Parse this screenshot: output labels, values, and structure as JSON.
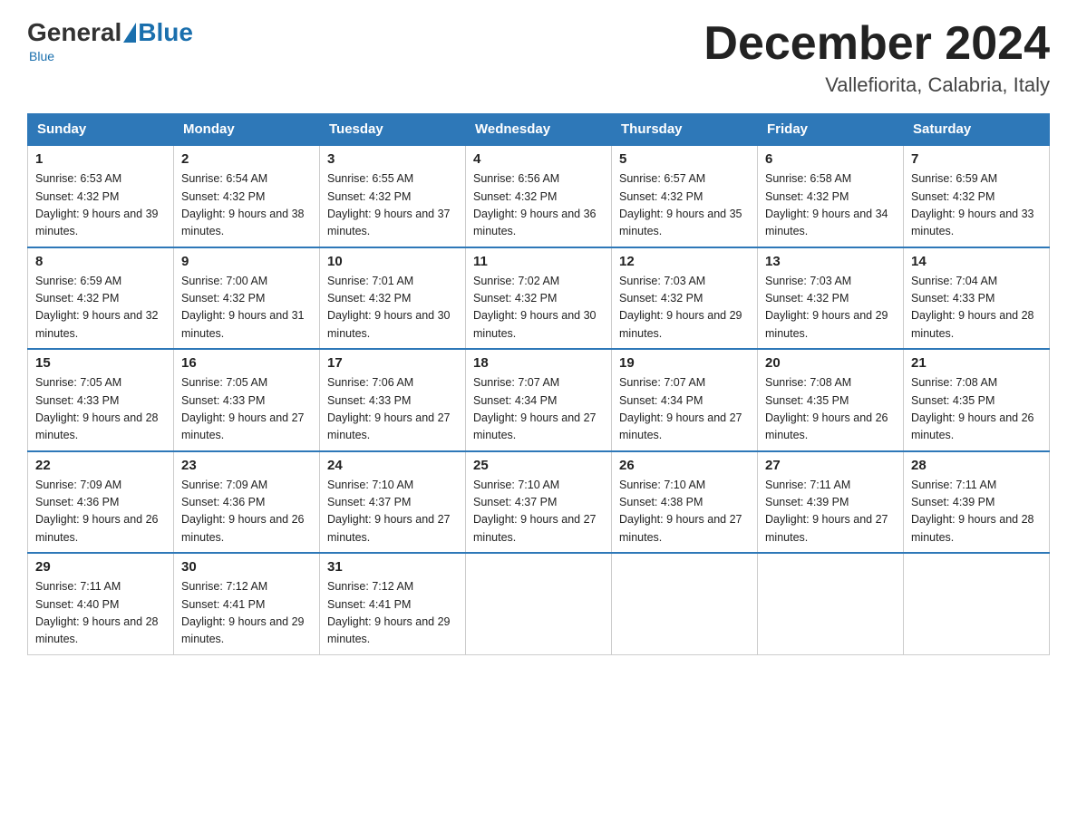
{
  "header": {
    "logo": {
      "general": "General",
      "blue": "Blue"
    },
    "month_title": "December 2024",
    "location": "Vallefiorita, Calabria, Italy"
  },
  "days_of_week": [
    "Sunday",
    "Monday",
    "Tuesday",
    "Wednesday",
    "Thursday",
    "Friday",
    "Saturday"
  ],
  "weeks": [
    [
      {
        "day": "1",
        "sunrise": "6:53 AM",
        "sunset": "4:32 PM",
        "daylight": "9 hours and 39 minutes."
      },
      {
        "day": "2",
        "sunrise": "6:54 AM",
        "sunset": "4:32 PM",
        "daylight": "9 hours and 38 minutes."
      },
      {
        "day": "3",
        "sunrise": "6:55 AM",
        "sunset": "4:32 PM",
        "daylight": "9 hours and 37 minutes."
      },
      {
        "day": "4",
        "sunrise": "6:56 AM",
        "sunset": "4:32 PM",
        "daylight": "9 hours and 36 minutes."
      },
      {
        "day": "5",
        "sunrise": "6:57 AM",
        "sunset": "4:32 PM",
        "daylight": "9 hours and 35 minutes."
      },
      {
        "day": "6",
        "sunrise": "6:58 AM",
        "sunset": "4:32 PM",
        "daylight": "9 hours and 34 minutes."
      },
      {
        "day": "7",
        "sunrise": "6:59 AM",
        "sunset": "4:32 PM",
        "daylight": "9 hours and 33 minutes."
      }
    ],
    [
      {
        "day": "8",
        "sunrise": "6:59 AM",
        "sunset": "4:32 PM",
        "daylight": "9 hours and 32 minutes."
      },
      {
        "day": "9",
        "sunrise": "7:00 AM",
        "sunset": "4:32 PM",
        "daylight": "9 hours and 31 minutes."
      },
      {
        "day": "10",
        "sunrise": "7:01 AM",
        "sunset": "4:32 PM",
        "daylight": "9 hours and 30 minutes."
      },
      {
        "day": "11",
        "sunrise": "7:02 AM",
        "sunset": "4:32 PM",
        "daylight": "9 hours and 30 minutes."
      },
      {
        "day": "12",
        "sunrise": "7:03 AM",
        "sunset": "4:32 PM",
        "daylight": "9 hours and 29 minutes."
      },
      {
        "day": "13",
        "sunrise": "7:03 AM",
        "sunset": "4:32 PM",
        "daylight": "9 hours and 29 minutes."
      },
      {
        "day": "14",
        "sunrise": "7:04 AM",
        "sunset": "4:33 PM",
        "daylight": "9 hours and 28 minutes."
      }
    ],
    [
      {
        "day": "15",
        "sunrise": "7:05 AM",
        "sunset": "4:33 PM",
        "daylight": "9 hours and 28 minutes."
      },
      {
        "day": "16",
        "sunrise": "7:05 AM",
        "sunset": "4:33 PM",
        "daylight": "9 hours and 27 minutes."
      },
      {
        "day": "17",
        "sunrise": "7:06 AM",
        "sunset": "4:33 PM",
        "daylight": "9 hours and 27 minutes."
      },
      {
        "day": "18",
        "sunrise": "7:07 AM",
        "sunset": "4:34 PM",
        "daylight": "9 hours and 27 minutes."
      },
      {
        "day": "19",
        "sunrise": "7:07 AM",
        "sunset": "4:34 PM",
        "daylight": "9 hours and 27 minutes."
      },
      {
        "day": "20",
        "sunrise": "7:08 AM",
        "sunset": "4:35 PM",
        "daylight": "9 hours and 26 minutes."
      },
      {
        "day": "21",
        "sunrise": "7:08 AM",
        "sunset": "4:35 PM",
        "daylight": "9 hours and 26 minutes."
      }
    ],
    [
      {
        "day": "22",
        "sunrise": "7:09 AM",
        "sunset": "4:36 PM",
        "daylight": "9 hours and 26 minutes."
      },
      {
        "day": "23",
        "sunrise": "7:09 AM",
        "sunset": "4:36 PM",
        "daylight": "9 hours and 26 minutes."
      },
      {
        "day": "24",
        "sunrise": "7:10 AM",
        "sunset": "4:37 PM",
        "daylight": "9 hours and 27 minutes."
      },
      {
        "day": "25",
        "sunrise": "7:10 AM",
        "sunset": "4:37 PM",
        "daylight": "9 hours and 27 minutes."
      },
      {
        "day": "26",
        "sunrise": "7:10 AM",
        "sunset": "4:38 PM",
        "daylight": "9 hours and 27 minutes."
      },
      {
        "day": "27",
        "sunrise": "7:11 AM",
        "sunset": "4:39 PM",
        "daylight": "9 hours and 27 minutes."
      },
      {
        "day": "28",
        "sunrise": "7:11 AM",
        "sunset": "4:39 PM",
        "daylight": "9 hours and 28 minutes."
      }
    ],
    [
      {
        "day": "29",
        "sunrise": "7:11 AM",
        "sunset": "4:40 PM",
        "daylight": "9 hours and 28 minutes."
      },
      {
        "day": "30",
        "sunrise": "7:12 AM",
        "sunset": "4:41 PM",
        "daylight": "9 hours and 29 minutes."
      },
      {
        "day": "31",
        "sunrise": "7:12 AM",
        "sunset": "4:41 PM",
        "daylight": "9 hours and 29 minutes."
      },
      null,
      null,
      null,
      null
    ]
  ],
  "labels": {
    "sunrise": "Sunrise:",
    "sunset": "Sunset:",
    "daylight": "Daylight:"
  }
}
